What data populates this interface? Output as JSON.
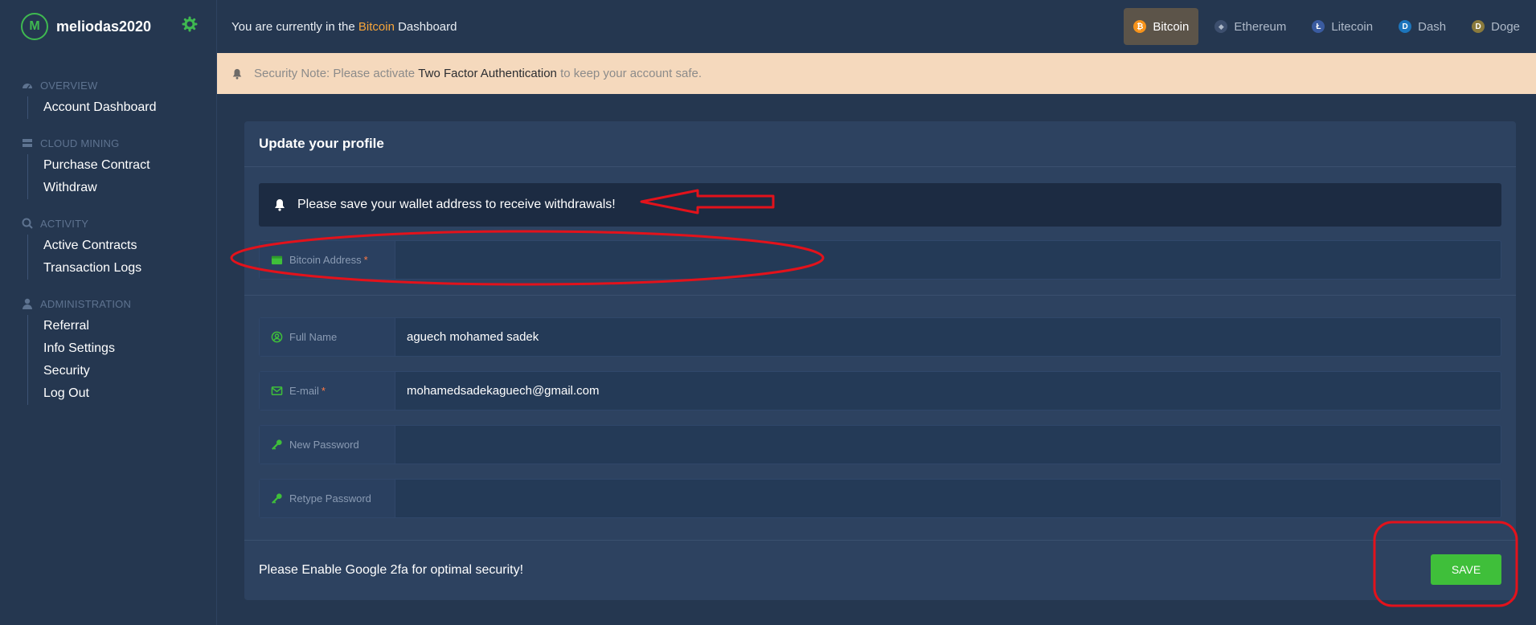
{
  "brand": {
    "logo_letter": "M",
    "name": "meliodas2020"
  },
  "sidebar": {
    "sections": [
      {
        "heading": "OVERVIEW",
        "items": [
          "Account Dashboard"
        ]
      },
      {
        "heading": "CLOUD MINING",
        "items": [
          "Purchase Contract",
          "Withdraw"
        ]
      },
      {
        "heading": "ACTIVITY",
        "items": [
          "Active Contracts",
          "Transaction Logs"
        ]
      },
      {
        "heading": "ADMINISTRATION",
        "items": [
          "Referral",
          "Info Settings",
          "Security",
          "Log Out"
        ]
      }
    ]
  },
  "topbar": {
    "prefix": "You are currently in the",
    "current_coin": "Bitcoin",
    "suffix": "Dashboard",
    "coins": [
      {
        "label": "Bitcoin",
        "glyph": "₿",
        "color": "#f7931a",
        "active": true
      },
      {
        "label": "Ethereum",
        "glyph": "◆",
        "color": "#3d4f6e",
        "active": false
      },
      {
        "label": "Litecoin",
        "glyph": "Ł",
        "color": "#3a5ba0",
        "active": false
      },
      {
        "label": "Dash",
        "glyph": "D",
        "color": "#1c75bc",
        "active": false
      },
      {
        "label": "Doge",
        "glyph": "D",
        "color": "#8a7a3c",
        "active": false
      }
    ]
  },
  "notice": {
    "prefix": "Security Note: Please activate",
    "highlight": "Two Factor Authentication",
    "suffix": "to keep your account safe."
  },
  "profile": {
    "title": "Update your profile",
    "alert": "Please save your wallet address to receive withdrawals!",
    "bitcoin_address": {
      "label": "Bitcoin Address",
      "required": "*",
      "value": ""
    },
    "full_name": {
      "label": "Full Name",
      "value": "aguech mohamed sadek"
    },
    "email": {
      "label": "E-mail",
      "required": "*",
      "value": "mohamedsadekaguech@gmail.com"
    },
    "new_password": {
      "label": "New Password",
      "value": ""
    },
    "retype_password": {
      "label": "Retype Password",
      "value": ""
    },
    "footer_text": "Please Enable Google 2fa for optimal security!",
    "save_label": "SAVE"
  },
  "colors": {
    "accent": "#3fb950",
    "bitcoin": "#f7a53a",
    "annotation": "#e3121b"
  }
}
